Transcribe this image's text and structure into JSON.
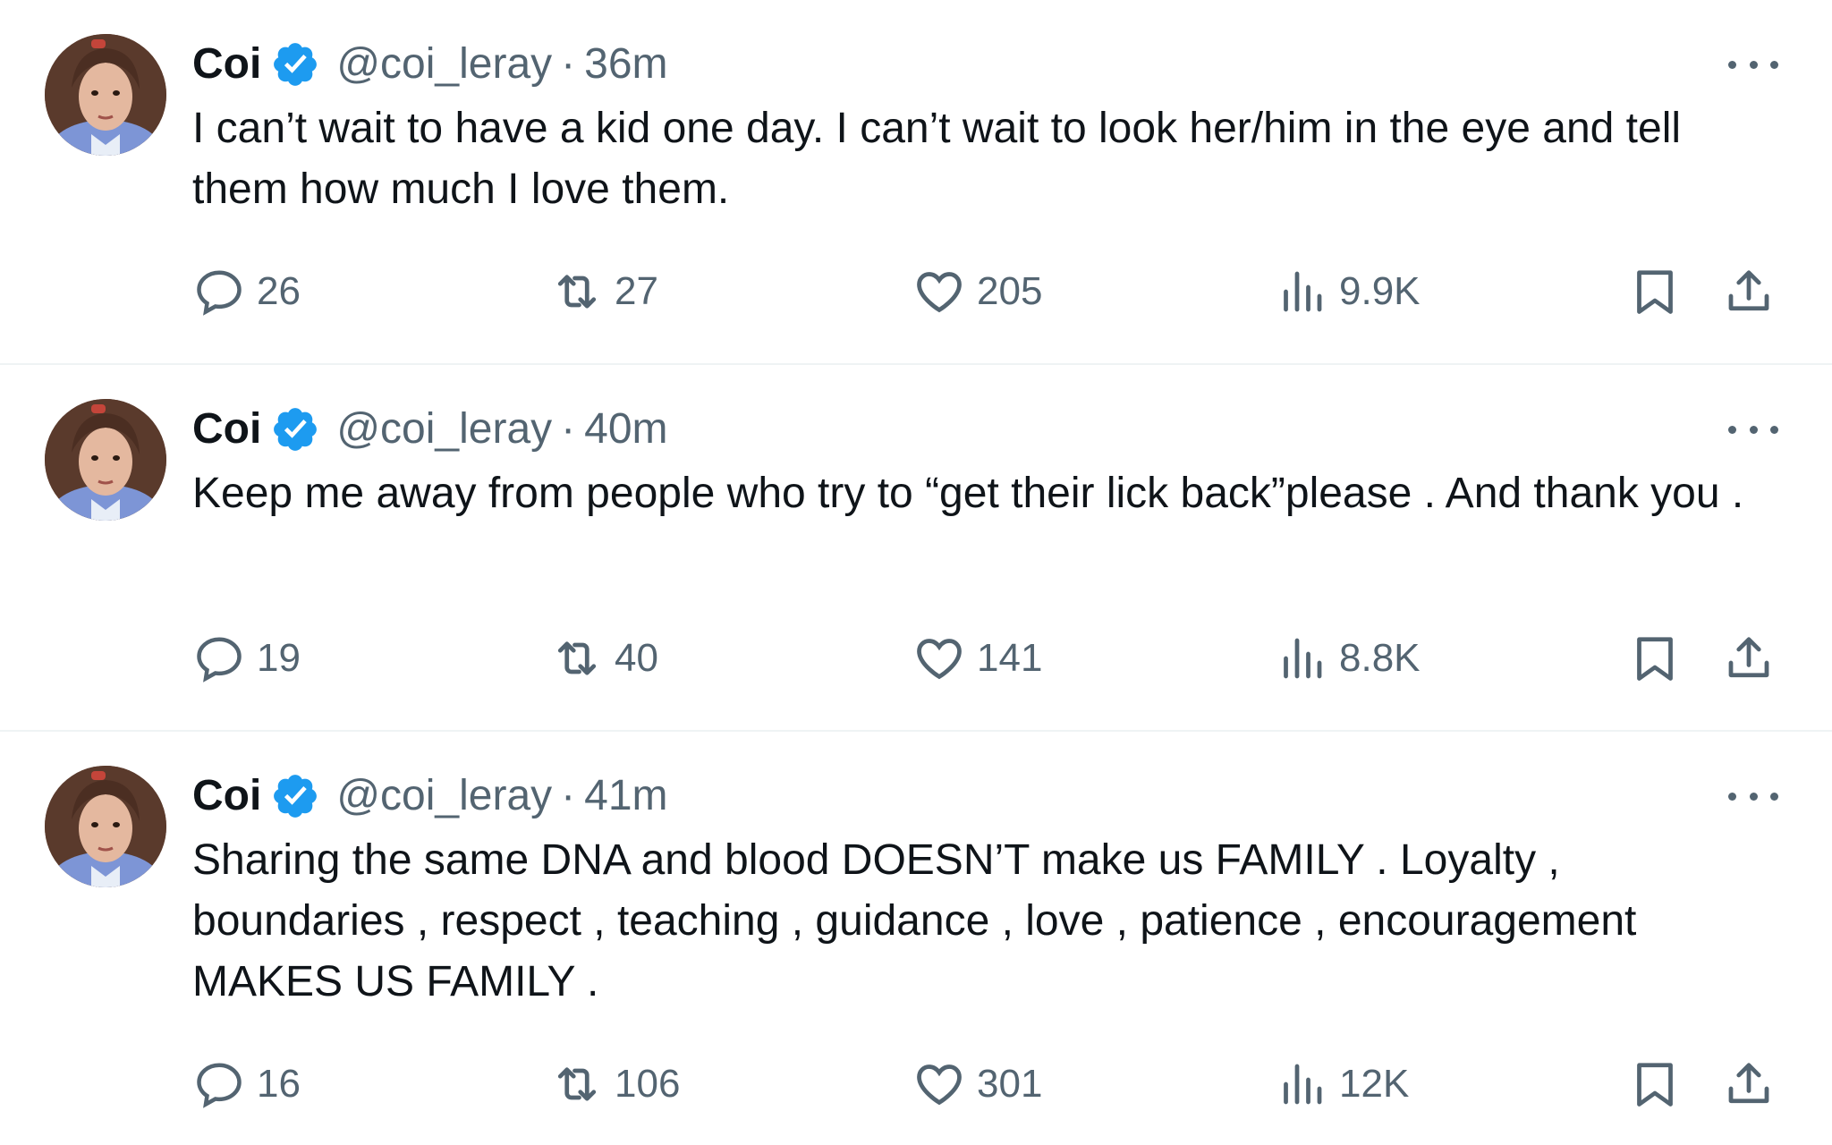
{
  "colors": {
    "text": "#0f1419",
    "secondary": "#536471",
    "verified": "#1d9bf0",
    "divider": "#eff3f4"
  },
  "tweets": [
    {
      "name": "Coi",
      "handle": "@coi_leray",
      "separator": "·",
      "time": "36m",
      "text": "I can’t wait to have a kid one day. I can’t wait to look her/him in the eye and tell them how much I love them.",
      "replies": "26",
      "retweets": "27",
      "likes": "205",
      "views": "9.9K"
    },
    {
      "name": "Coi",
      "handle": "@coi_leray",
      "separator": "·",
      "time": "40m",
      "text": "Keep me away from people who try to “get their lick back”please . And thank you .",
      "replies": "19",
      "retweets": "40",
      "likes": "141",
      "views": "8.8K"
    },
    {
      "name": "Coi",
      "handle": "@coi_leray",
      "separator": "·",
      "time": "41m",
      "text": "Sharing the same DNA and blood DOESN’T make us FAMILY . Loyalty , boundaries , respect , teaching , guidance , love , patience , encouragement MAKES US FAMILY .",
      "replies": "16",
      "retweets": "106",
      "likes": "301",
      "views": "12K"
    }
  ],
  "icons": {
    "avatar": "profile-photo",
    "verified": "verified-badge-icon",
    "more": "more-options-icon",
    "reply": "reply-icon",
    "retweet": "retweet-icon",
    "like": "heart-icon",
    "views": "views-chart-icon",
    "bookmark": "bookmark-icon",
    "share": "share-icon"
  }
}
